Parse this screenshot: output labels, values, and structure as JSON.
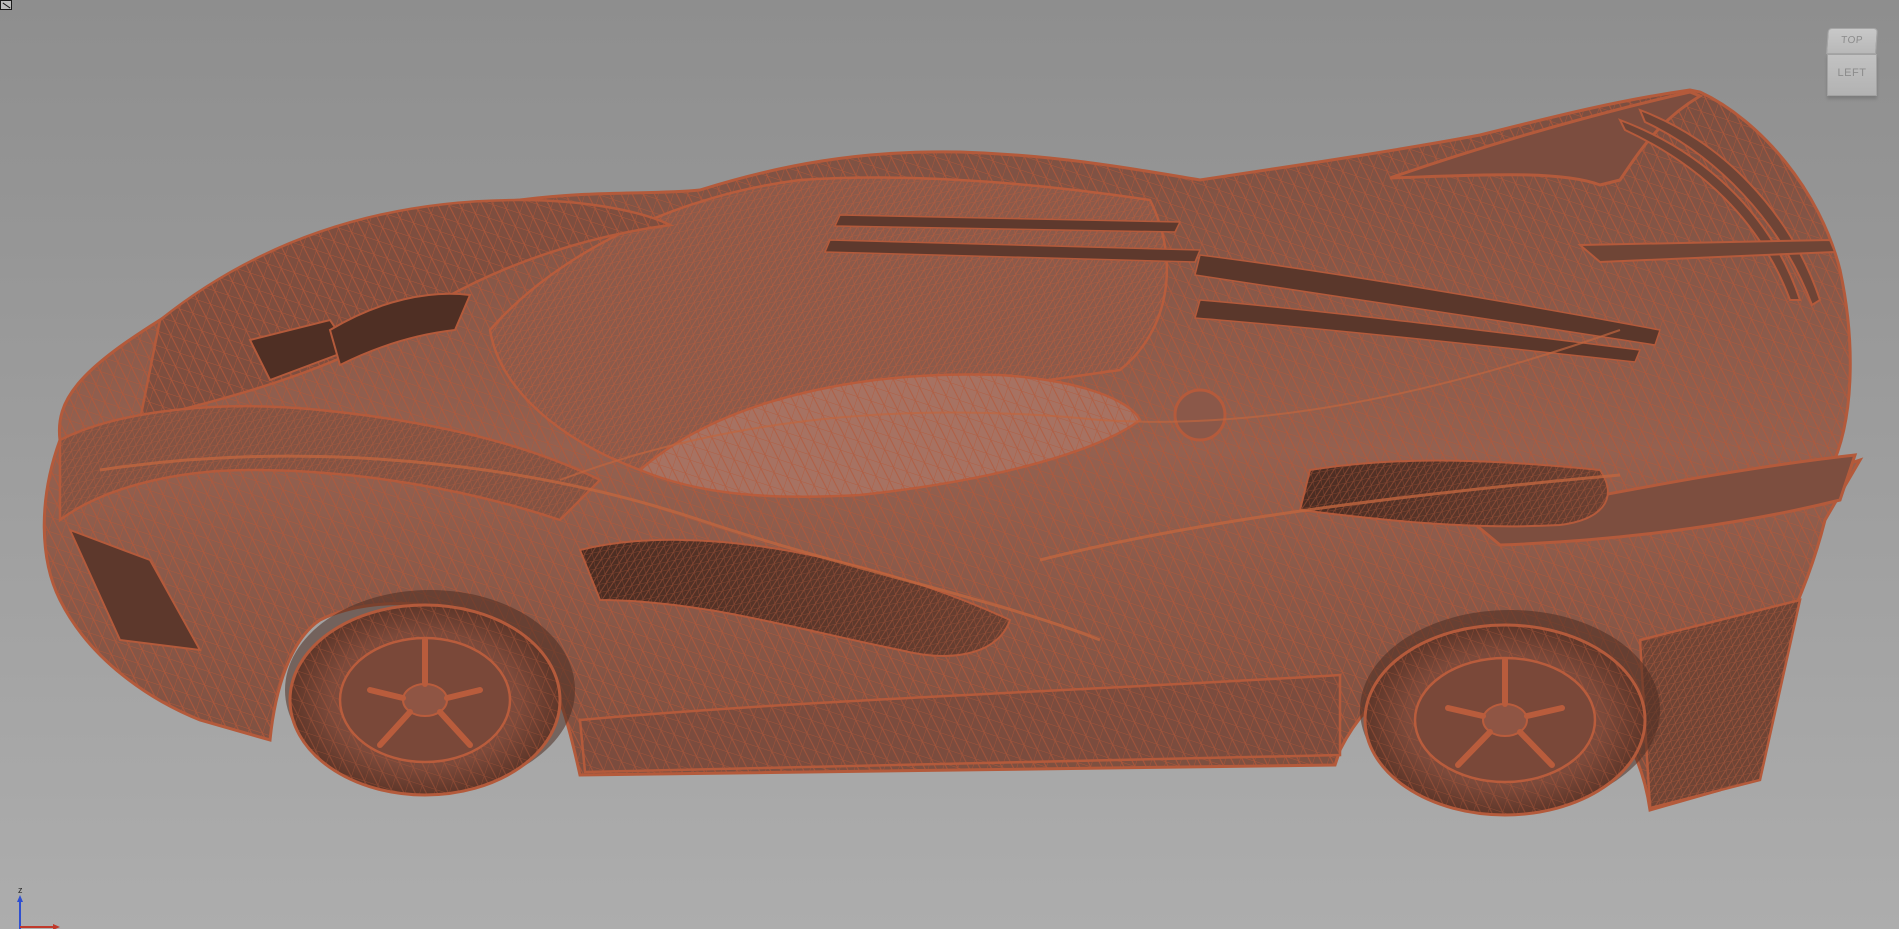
{
  "viewport": {
    "background_top": "#8e8e8e",
    "background_bottom": "#adadad",
    "mesh_color": "#b25a3e",
    "surface_color": "#8f5a48",
    "model_description_icon": "sports-car-wireframe"
  },
  "viewcube": {
    "top_label": "TOP",
    "front_label": "LEFT"
  },
  "axis": {
    "z_label": "z",
    "z_color": "#2f4fd0",
    "x_color": "#c0392b"
  }
}
